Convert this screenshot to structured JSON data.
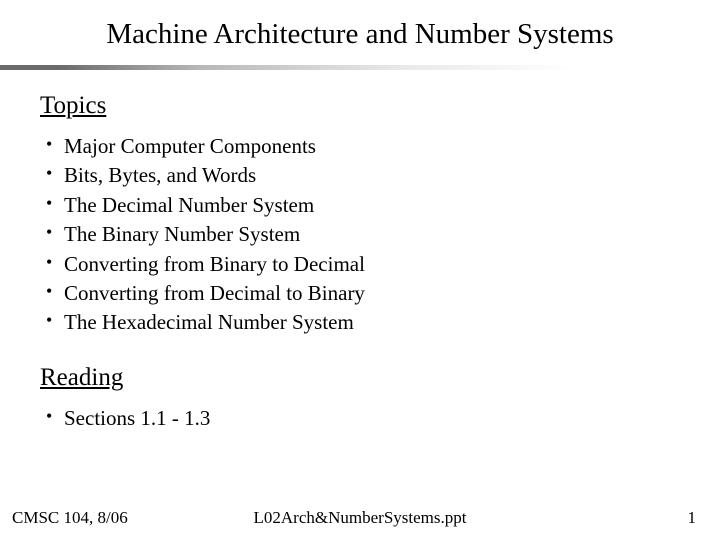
{
  "title": "Machine Architecture and Number Systems",
  "sections": {
    "topics": {
      "heading": "Topics",
      "items": [
        "Major Computer Components",
        "Bits, Bytes, and Words",
        "The Decimal Number System",
        "The Binary Number System",
        "Converting from Binary to Decimal",
        "Converting from Decimal to Binary",
        "The Hexadecimal Number System"
      ]
    },
    "reading": {
      "heading": "Reading",
      "items": [
        "Sections 1.1 - 1.3"
      ]
    }
  },
  "footer": {
    "left": "CMSC 104, 8/06",
    "center": "L02Arch&NumberSystems.ppt",
    "right": "1"
  }
}
